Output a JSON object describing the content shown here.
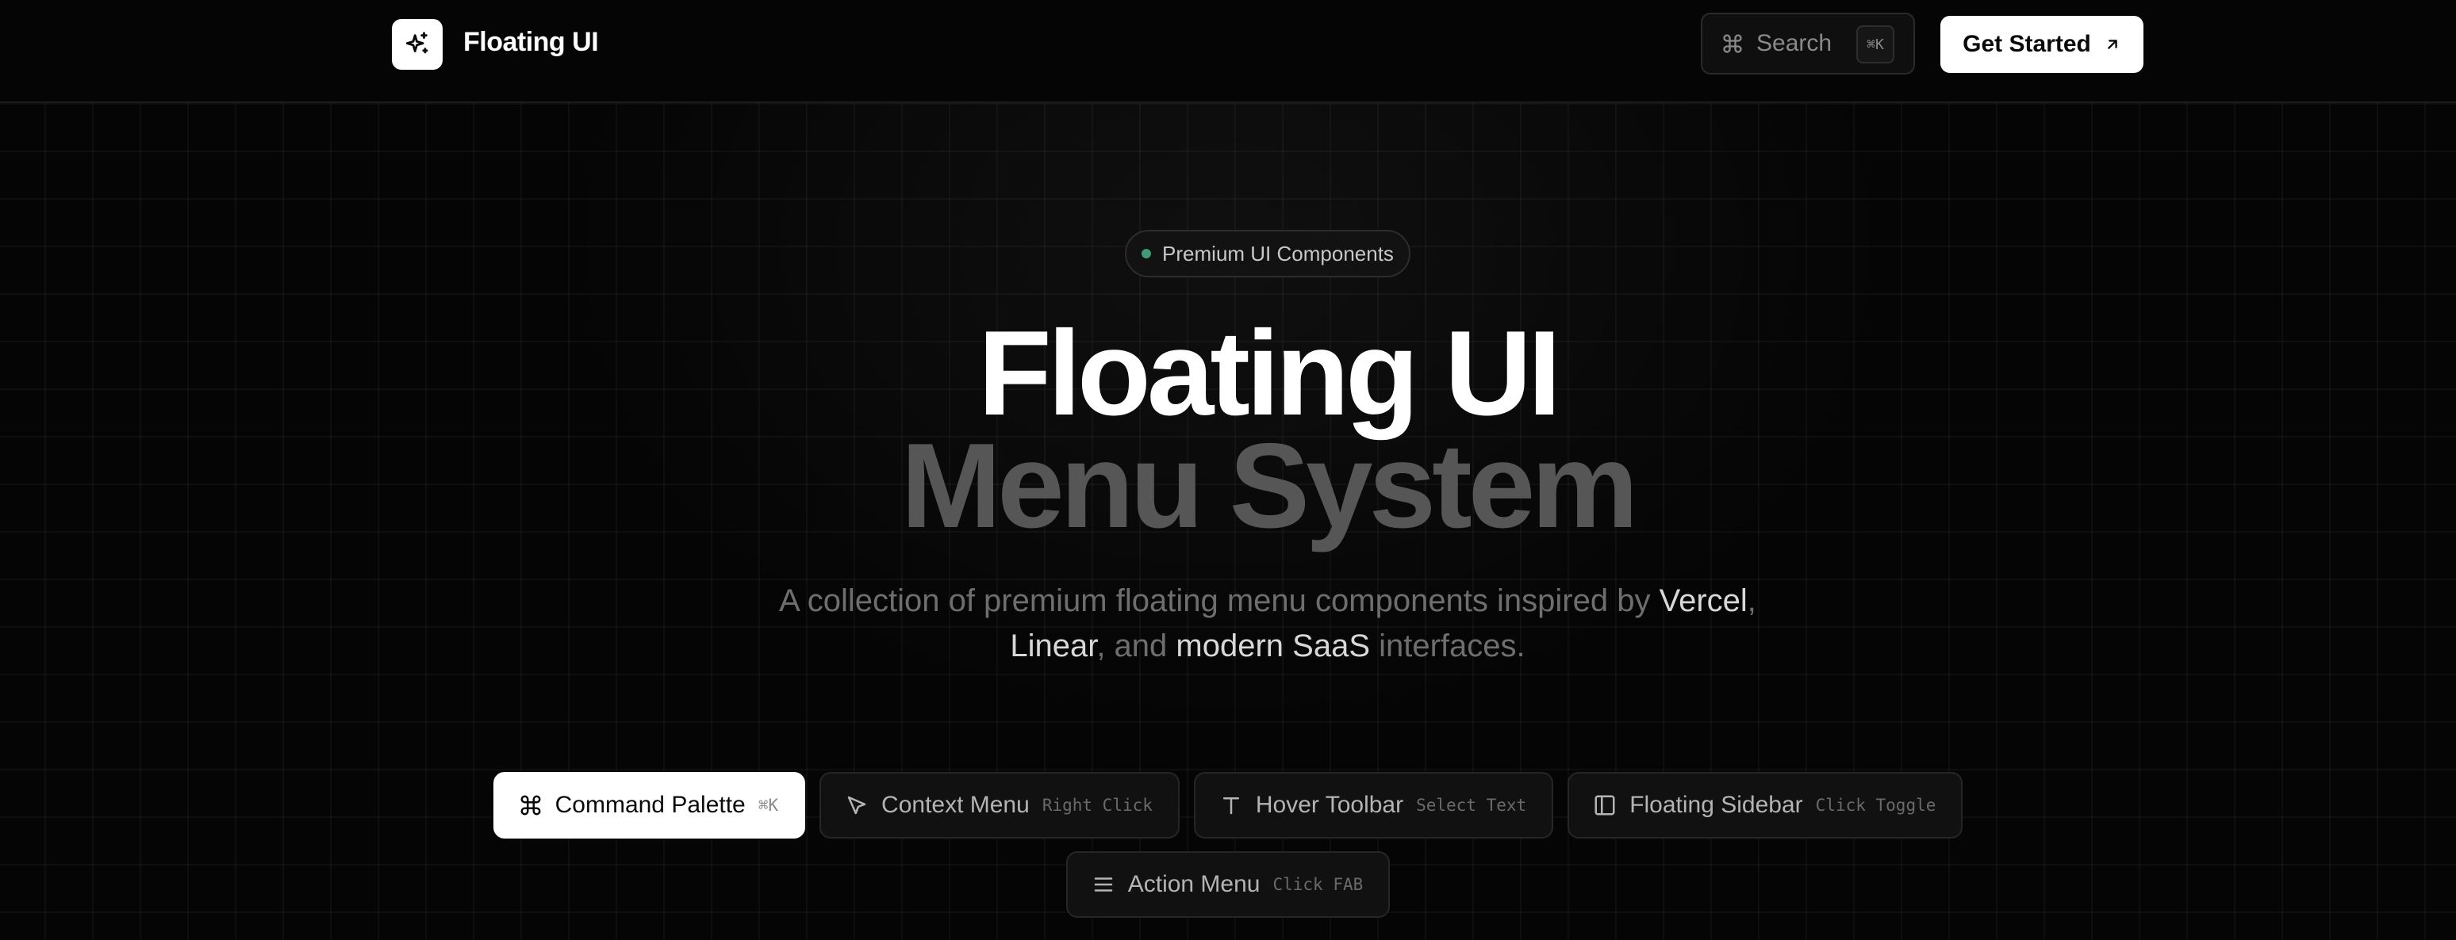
{
  "header": {
    "logo_text": "Floating UI",
    "search_label": "Search",
    "search_shortcut": "⌘K",
    "cta_label": "Get Started"
  },
  "hero": {
    "badge": "Premium UI Components",
    "title_line1": "Floating UI",
    "title_line2": "Menu System",
    "subtitle": {
      "part1": "A collection of premium floating menu components inspired by ",
      "highlight1": "Vercel",
      "part2": ",",
      "highlight2": "Linear",
      "part3": ", and ",
      "highlight3": "modern SaaS",
      "part4": " interfaces."
    }
  },
  "tabs": [
    {
      "label": "Command Palette",
      "hint": "⌘K",
      "icon": "command-icon",
      "active": true
    },
    {
      "label": "Context Menu",
      "hint": "Right Click",
      "icon": "cursor-icon",
      "active": false
    },
    {
      "label": "Hover Toolbar",
      "hint": "Select Text",
      "icon": "type-icon",
      "active": false
    },
    {
      "label": "Floating Sidebar",
      "hint": "Click Toggle",
      "icon": "sidebar-icon",
      "active": false
    },
    {
      "label": "Action Menu",
      "hint": "Click FAB",
      "icon": "menu-icon",
      "active": false
    }
  ],
  "colors": {
    "background": "#050505",
    "accent_dot": "#3f9b76",
    "title_secondary": "#565656"
  }
}
